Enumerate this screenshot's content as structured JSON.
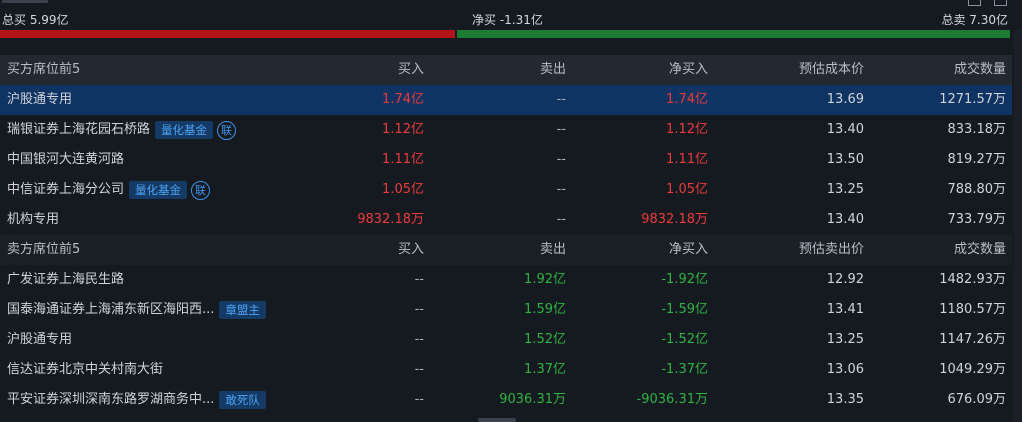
{
  "summary": {
    "total_buy": "总买 5.99亿",
    "net_buy": "净买 -1.31亿",
    "total_sell": "总卖 7.30亿",
    "buy_share": 0.45
  },
  "buy_section": {
    "headers": {
      "name": "买方席位前5",
      "buy": "买入",
      "sell": "卖出",
      "net": "净买入",
      "cost": "预估成本价",
      "volume": "成交数量"
    },
    "rows": [
      {
        "name": "沪股通专用",
        "buy": "1.74亿",
        "sell": "--",
        "net": "1.74亿",
        "cost": "13.69",
        "volume": "1271.57万"
      },
      {
        "name": "瑞银证券上海花园石桥路",
        "tag": "量化基金",
        "badge": "联",
        "buy": "1.12亿",
        "sell": "--",
        "net": "1.12亿",
        "cost": "13.40",
        "volume": "833.18万"
      },
      {
        "name": "中国银河大连黄河路",
        "buy": "1.11亿",
        "sell": "--",
        "net": "1.11亿",
        "cost": "13.50",
        "volume": "819.27万"
      },
      {
        "name": "中信证券上海分公司",
        "tag": "量化基金",
        "badge": "联",
        "buy": "1.05亿",
        "sell": "--",
        "net": "1.05亿",
        "cost": "13.25",
        "volume": "788.80万"
      },
      {
        "name": "机构专用",
        "buy": "9832.18万",
        "sell": "--",
        "net": "9832.18万",
        "cost": "13.40",
        "volume": "733.79万"
      }
    ]
  },
  "sell_section": {
    "headers": {
      "name": "卖方席位前5",
      "buy": "买入",
      "sell": "卖出",
      "net": "净买入",
      "cost": "预估卖出价",
      "volume": "成交数量"
    },
    "rows": [
      {
        "name": "广发证券上海民生路",
        "buy": "--",
        "sell": "1.92亿",
        "net": "-1.92亿",
        "cost": "12.92",
        "volume": "1482.93万"
      },
      {
        "name": "国泰海通证券上海浦东新区海阳西...",
        "tag": "章盟主",
        "buy": "--",
        "sell": "1.59亿",
        "net": "-1.59亿",
        "cost": "13.41",
        "volume": "1180.57万"
      },
      {
        "name": "沪股通专用",
        "buy": "--",
        "sell": "1.52亿",
        "net": "-1.52亿",
        "cost": "13.25",
        "volume": "1147.26万"
      },
      {
        "name": "信达证券北京中关村南大街",
        "buy": "--",
        "sell": "1.37亿",
        "net": "-1.37亿",
        "cost": "13.06",
        "volume": "1049.29万"
      },
      {
        "name": "平安证券深圳深南东路罗湖商务中...",
        "tag": "敢死队",
        "buy": "--",
        "sell": "9036.31万",
        "net": "-9036.31万",
        "cost": "13.35",
        "volume": "676.09万"
      }
    ]
  },
  "colors": {
    "buy": "#ec3b3b",
    "sell": "#2fb342",
    "selected_row": "#0f3362",
    "tag_bg": "#153a66",
    "tag_text": "#4ea3f2"
  }
}
